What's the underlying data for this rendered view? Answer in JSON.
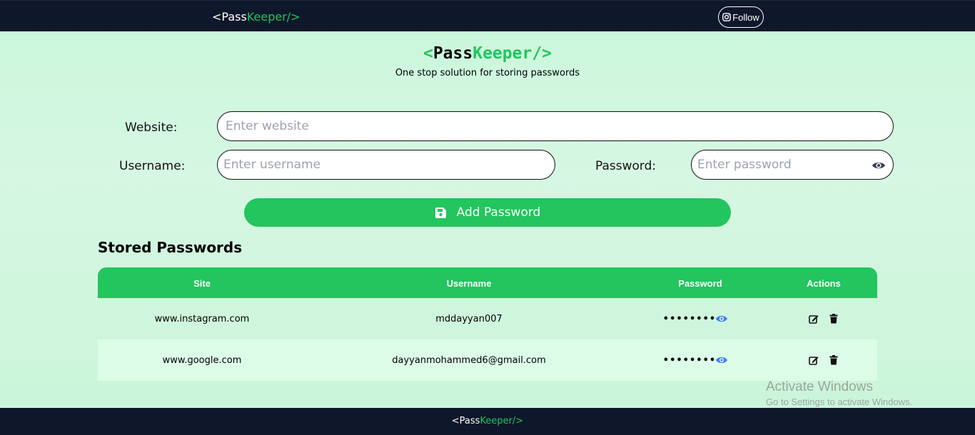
{
  "navbar": {
    "logo_open": "<Pass",
    "logo_green": "Keeper/>",
    "follow_label": "Follow"
  },
  "header": {
    "brand_open": "<",
    "brand_pass": "Pass",
    "brand_keeper": "Keeper",
    "brand_close": "/>",
    "tagline": "One stop solution for storing passwords"
  },
  "form": {
    "website_label": "Website:",
    "website_placeholder": "Enter website",
    "username_label": "Username:",
    "username_placeholder": "Enter username",
    "password_label": "Password:",
    "password_placeholder": "Enter password",
    "add_button_label": "Add Password"
  },
  "stored": {
    "title": "Stored Passwords",
    "columns": [
      "Site",
      "Username",
      "Password",
      "Actions"
    ],
    "rows": [
      {
        "site": "www.instagram.com",
        "username": "mddayyan007",
        "password": "••••••••"
      },
      {
        "site": "www.google.com",
        "username": "dayyanmohammed6@gmail.com",
        "password": "••••••••"
      }
    ]
  },
  "footer": {
    "logo_open": "<Pass",
    "logo_green": "Keeper/>"
  },
  "watermark": {
    "line1": "Activate Windows",
    "line2": "Go to Settings to activate Windows."
  },
  "colors": {
    "accent": "#22c55e",
    "navbar": "#0f172a",
    "background": "#c8f7da",
    "eye": "#3b82f6"
  }
}
